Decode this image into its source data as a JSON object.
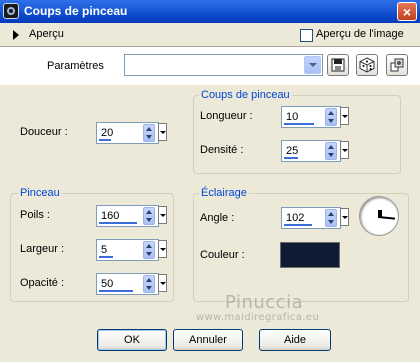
{
  "window": {
    "title": "Coups de pinceau",
    "close_glyph": "×"
  },
  "preview": {
    "label": "Aperçu",
    "image_preview_label": "Aperçu de l'image",
    "image_preview_checked": false
  },
  "params": {
    "label": "Paramètres",
    "preset_value": ""
  },
  "douceur": {
    "label": "Douceur :",
    "value": "20"
  },
  "brush_strokes": {
    "title": "Coups de pinceau",
    "length": {
      "label": "Longueur :",
      "value": "10"
    },
    "density": {
      "label": "Densité :",
      "value": "25"
    }
  },
  "brush": {
    "title": "Pinceau",
    "bristles": {
      "label": "Poils :",
      "value": "160"
    },
    "width": {
      "label": "Largeur :",
      "value": "5"
    },
    "opacity": {
      "label": "Opacité :",
      "value": "50"
    }
  },
  "lighting": {
    "title": "Éclairage",
    "angle": {
      "label": "Angle :",
      "value": "102"
    },
    "color": {
      "label": "Couleur :",
      "hex": "#0f1a33"
    }
  },
  "watermark": {
    "line1": "Pinuccia",
    "line2": "www.maidiregrafica.eu"
  },
  "buttons": {
    "ok": "OK",
    "cancel": "Annuler",
    "help": "Aide"
  },
  "icons": [
    "app-icon",
    "close-icon",
    "expand-triangle-icon",
    "save-icon",
    "dice-icon",
    "reset-icon",
    "chevron-down-icon"
  ]
}
